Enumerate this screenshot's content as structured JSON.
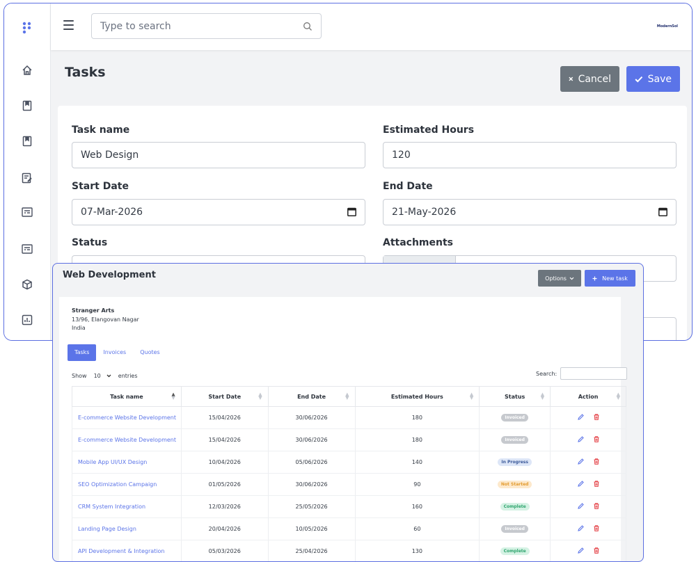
{
  "topbar": {
    "search_placeholder": "Type to search",
    "brand": "ModernSol"
  },
  "page": {
    "title": "Tasks",
    "cancel_label": "Cancel",
    "save_label": "Save"
  },
  "form": {
    "task_name_label": "Task name",
    "task_name_value": "Web Design",
    "estimated_hours_label": "Estimated Hours",
    "estimated_hours_value": "120",
    "start_date_label": "Start Date",
    "start_date_value": "07-Mar-2026",
    "end_date_label": "End Date",
    "end_date_value": "21-May-2026",
    "status_label": "Status",
    "attachments_label": "Attachments"
  },
  "project": {
    "title": "Web Development",
    "options_label": "Options",
    "new_task_label": "New task",
    "company": "Stranger Arts",
    "address_line1": "13/96, Elangovan Nagar",
    "address_line2": "India",
    "tabs": [
      "Tasks",
      "Invoices",
      "Quotes"
    ],
    "show_label": "Show",
    "entries_value": "10",
    "entries_label": "entries",
    "search_label": "Search:"
  },
  "table": {
    "columns": [
      "Task name",
      "Start Date",
      "End Date",
      "Estimated Hours",
      "Status",
      "Action"
    ],
    "rows": [
      {
        "name": "E-commerce Website Development",
        "start": "15/04/2026",
        "end": "30/06/2026",
        "hours": "180",
        "status": "Invoiced"
      },
      {
        "name": "E-commerce Website Development",
        "start": "15/04/2026",
        "end": "30/06/2026",
        "hours": "180",
        "status": "Invoiced"
      },
      {
        "name": "Mobile App UI/UX Design",
        "start": "10/04/2026",
        "end": "05/06/2026",
        "hours": "140",
        "status": "In Progress"
      },
      {
        "name": "SEO Optimization Campaign",
        "start": "01/05/2026",
        "end": "30/06/2026",
        "hours": "90",
        "status": "Not Started"
      },
      {
        "name": "CRM System Integration",
        "start": "12/03/2026",
        "end": "25/05/2026",
        "hours": "160",
        "status": "Complete"
      },
      {
        "name": "Landing Page Design",
        "start": "20/04/2026",
        "end": "10/05/2026",
        "hours": "60",
        "status": "Invoiced"
      },
      {
        "name": "API Development & Integration",
        "start": "05/03/2026",
        "end": "25/04/2026",
        "hours": "130",
        "status": "Complete"
      }
    ]
  },
  "status_colors": {
    "Invoiced": {
      "bg": "#c6c9ce",
      "fg": "#ffffff"
    },
    "In Progress": {
      "bg": "#dde6f7",
      "fg": "#3c5a9a"
    },
    "Not Started": {
      "bg": "#fde9cc",
      "fg": "#e29b2e"
    },
    "Complete": {
      "bg": "#d5f2e4",
      "fg": "#2fa56e"
    }
  },
  "colors": {
    "accent": "#5b74e8",
    "secondary": "#6c757d",
    "danger": "#e5484d"
  }
}
